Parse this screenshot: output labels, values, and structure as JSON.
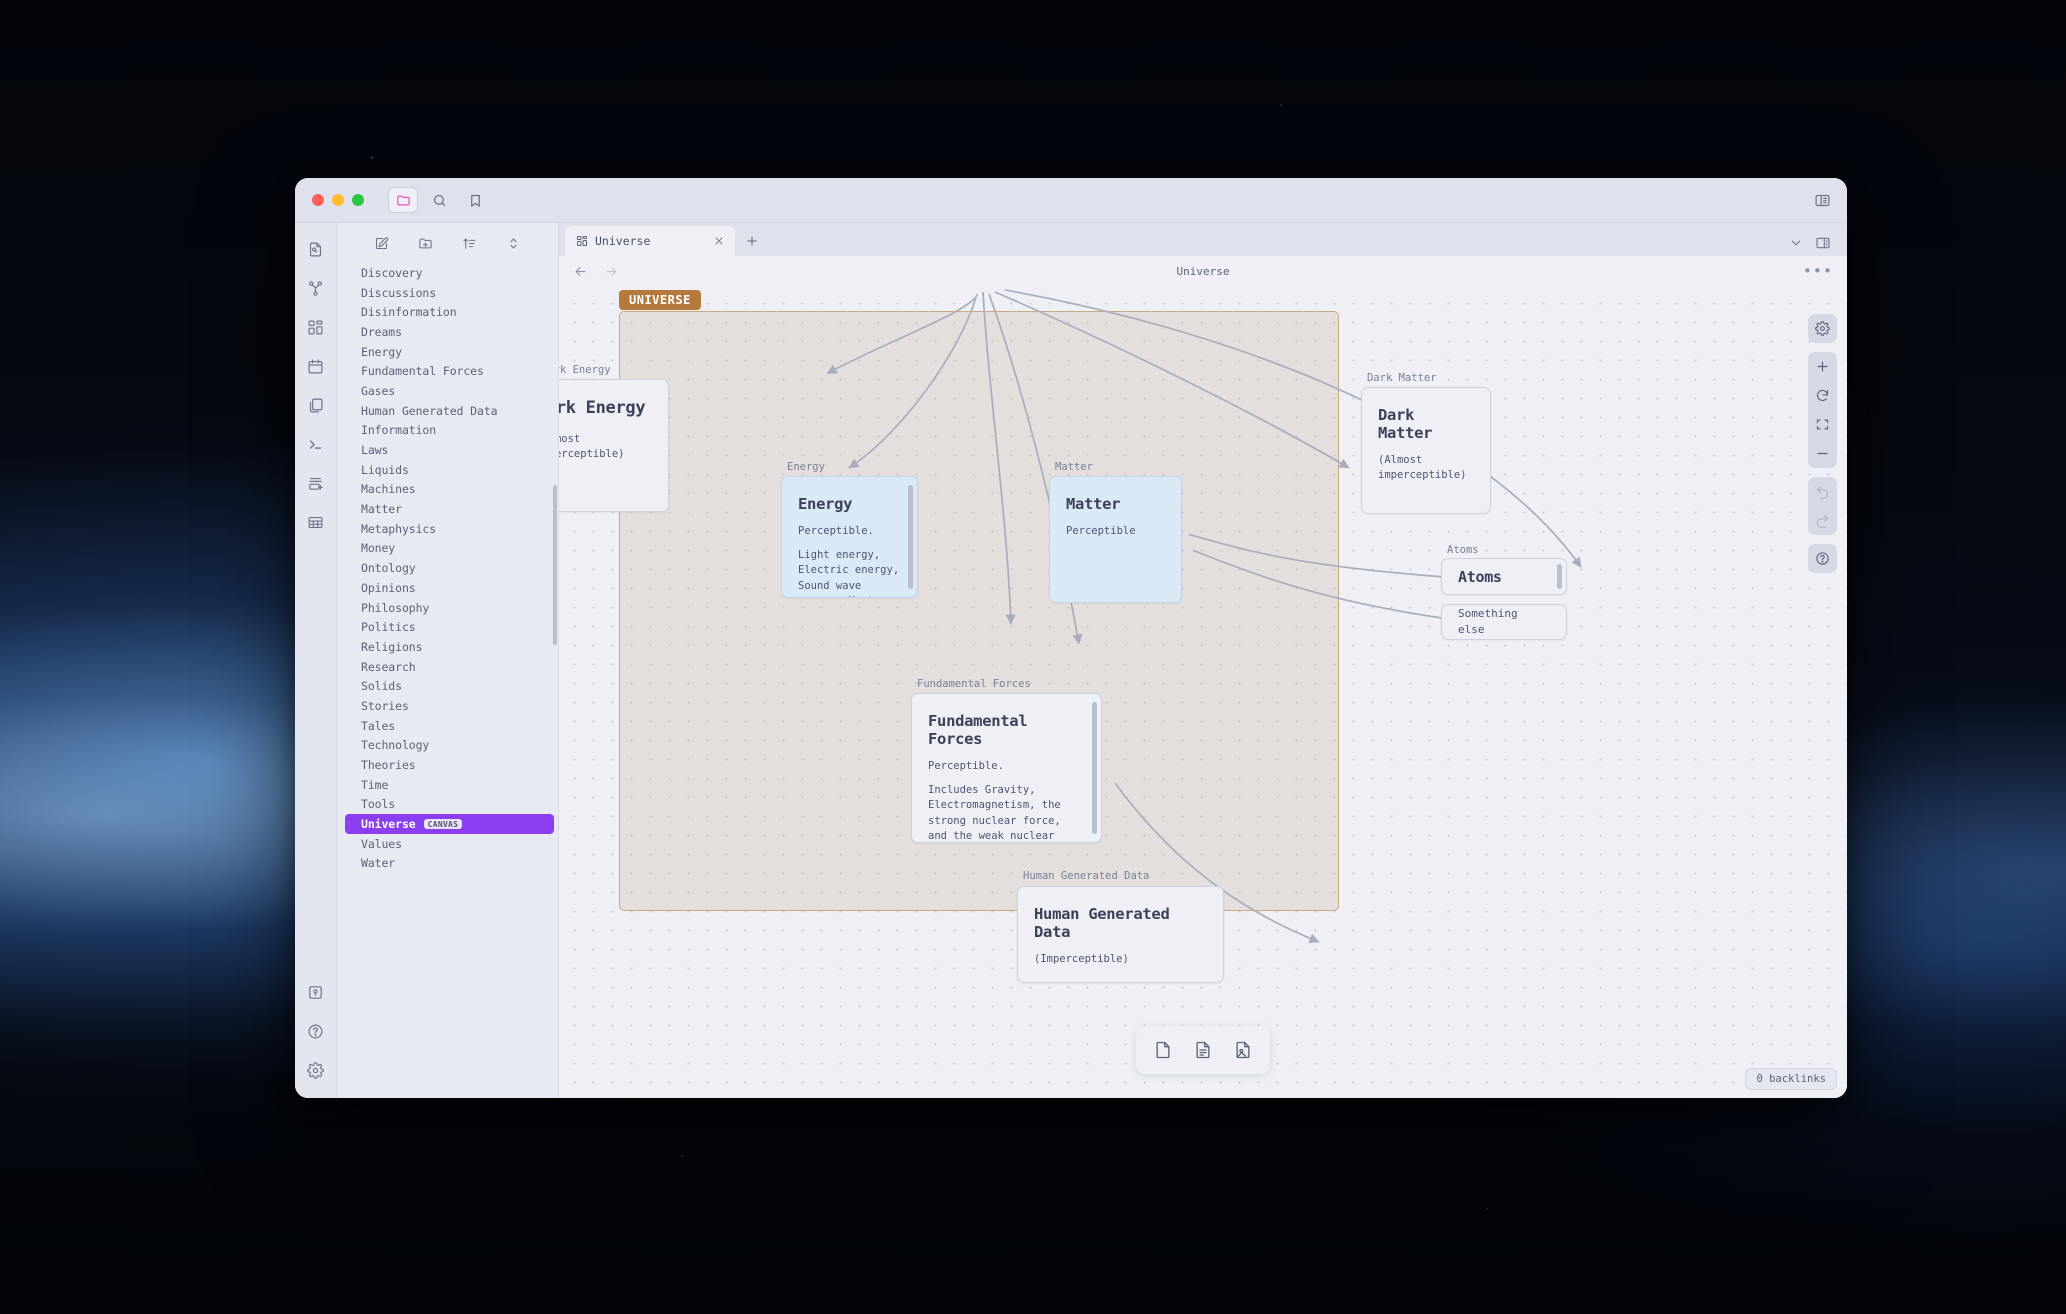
{
  "window": {
    "traffic_lights": [
      "close",
      "minimize",
      "maximize"
    ],
    "titlebar_icons": [
      "folder-icon",
      "search-icon",
      "bookmark-icon"
    ],
    "right_sidebar_toggle": "sidebar-right-icon"
  },
  "rail": {
    "top_icons": [
      "file-search-icon",
      "graph-view-icon",
      "canvas-icon",
      "calendar-icon",
      "templates-icon",
      "terminal-icon",
      "stack-add-icon",
      "table-icon"
    ],
    "bottom_icons": [
      "vault-icon",
      "help-icon",
      "settings-icon"
    ]
  },
  "sidebar": {
    "toolbar_icons": [
      "new-note-icon",
      "new-folder-icon",
      "sort-icon",
      "collapse-icon"
    ],
    "items": [
      {
        "label": "Discovery",
        "selected": false
      },
      {
        "label": "Discussions",
        "selected": false
      },
      {
        "label": "Disinformation",
        "selected": false
      },
      {
        "label": "Dreams",
        "selected": false
      },
      {
        "label": "Energy",
        "selected": false
      },
      {
        "label": "Fundamental Forces",
        "selected": false
      },
      {
        "label": "Gases",
        "selected": false
      },
      {
        "label": "Human Generated Data",
        "selected": false
      },
      {
        "label": "Information",
        "selected": false
      },
      {
        "label": "Laws",
        "selected": false
      },
      {
        "label": "Liquids",
        "selected": false
      },
      {
        "label": "Machines",
        "selected": false
      },
      {
        "label": "Matter",
        "selected": false
      },
      {
        "label": "Metaphysics",
        "selected": false
      },
      {
        "label": "Money",
        "selected": false
      },
      {
        "label": "Ontology",
        "selected": false
      },
      {
        "label": "Opinions",
        "selected": false
      },
      {
        "label": "Philosophy",
        "selected": false
      },
      {
        "label": "Politics",
        "selected": false
      },
      {
        "label": "Religions",
        "selected": false
      },
      {
        "label": "Research",
        "selected": false
      },
      {
        "label": "Solids",
        "selected": false
      },
      {
        "label": "Stories",
        "selected": false
      },
      {
        "label": "Tales",
        "selected": false
      },
      {
        "label": "Technology",
        "selected": false
      },
      {
        "label": "Theories",
        "selected": false
      },
      {
        "label": "Time",
        "selected": false
      },
      {
        "label": "Tools",
        "selected": false
      },
      {
        "label": "Universe",
        "selected": true,
        "badge": "CANVAS"
      },
      {
        "label": "Values",
        "selected": false
      },
      {
        "label": "Water",
        "selected": false
      }
    ]
  },
  "tabs": [
    {
      "label": "Universe",
      "icon": "canvas-icon",
      "active": true
    }
  ],
  "view": {
    "title": "Universe",
    "back_icon": "arrow-left-icon",
    "forward_icon": "arrow-right-icon",
    "more_icon": "more-horizontal-icon",
    "backlinks": "0 backlinks"
  },
  "canvas": {
    "group_label": "UNIVERSE",
    "controls": [
      "settings-icon",
      "zoom-in-icon",
      "reset-zoom-icon",
      "fit-view-icon",
      "zoom-out-icon",
      "undo-icon",
      "redo-icon",
      "help-icon"
    ],
    "card_toolbar": [
      "add-card-icon",
      "add-note-icon",
      "add-image-icon"
    ],
    "nodes": [
      {
        "id": "dark-energy",
        "label": "Dark Energy",
        "title": "Dark Energy",
        "body": [
          "(Almost imperceptible)"
        ],
        "color": "default"
      },
      {
        "id": "energy",
        "label": "Energy",
        "title": "Energy",
        "body": [
          "Perceptible.",
          "Light energy, Electric energy, Sound wave energy, Heat energy, others"
        ],
        "color": "blue"
      },
      {
        "id": "matter",
        "label": "Matter",
        "title": "Matter",
        "body": [
          "Perceptible"
        ],
        "color": "blue"
      },
      {
        "id": "dark-matter",
        "label": "Dark Matter",
        "title": "Dark Matter",
        "body": [
          "(Almost imperceptible)"
        ],
        "color": "default"
      },
      {
        "id": "atoms",
        "label": "Atoms",
        "title": "Atoms",
        "body": [],
        "color": "default"
      },
      {
        "id": "something-else",
        "label": "",
        "title": "",
        "body": [
          "Something else"
        ],
        "color": "default"
      },
      {
        "id": "fundamental-forces",
        "label": "Fundamental Forces",
        "title": "Fundamental Forces",
        "body": [
          "Perceptible.",
          "Includes Gravity, Electromagnetism, the strong nuclear force, and the weak nuclear force, which govern the interactions between particles and the behavior of matter and energy in the universe."
        ],
        "color": "default"
      },
      {
        "id": "human-generated-data",
        "label": "Human Generated Data",
        "title": "Human Generated Data",
        "body": [
          "(Imperceptible)"
        ],
        "color": "default"
      }
    ]
  },
  "colors": {
    "accent": "#8b3ef0",
    "group_border": "#c9a882",
    "group_label_bg": "#b5793c",
    "card_blue": "#d9eaf6",
    "edge": "#a8adbd"
  }
}
